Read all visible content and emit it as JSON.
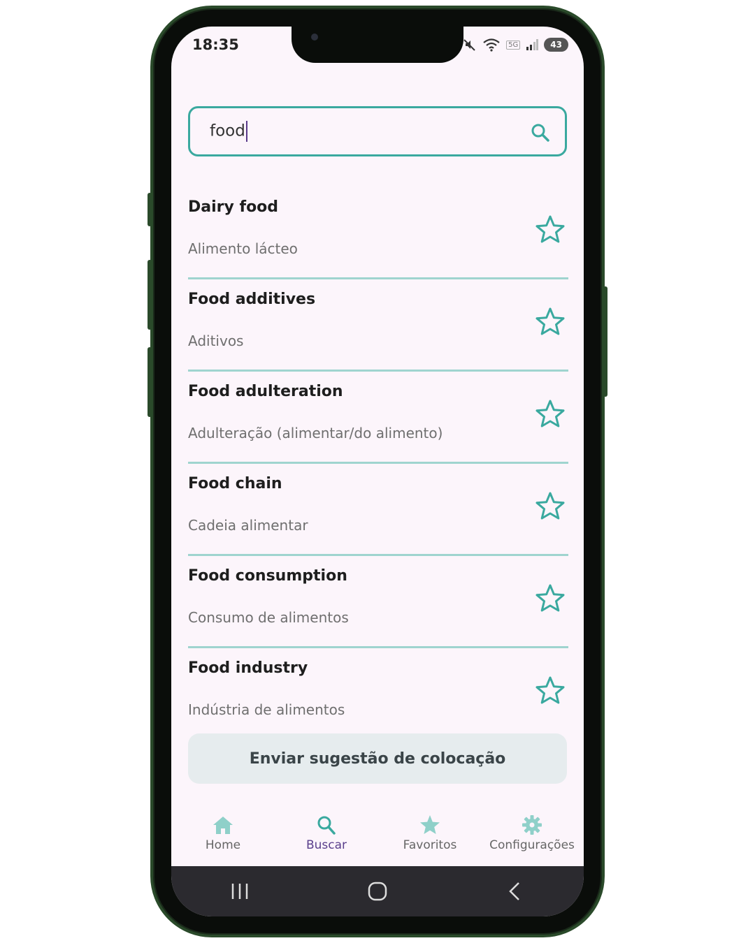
{
  "status_bar": {
    "time": "18:35",
    "battery": "43",
    "network_label": "5G"
  },
  "search": {
    "value": "food"
  },
  "results": [
    {
      "term": "Dairy food",
      "translation": "Alimento lácteo"
    },
    {
      "term": "Food additives",
      "translation": "Aditivos"
    },
    {
      "term": "Food adulteration",
      "translation": "Adulteração (alimentar/do alimento)"
    },
    {
      "term": "Food chain",
      "translation": "Cadeia alimentar"
    },
    {
      "term": "Food consumption",
      "translation": "Consumo de alimentos"
    },
    {
      "term": "Food industry",
      "translation": "Indústria de alimentos"
    }
  ],
  "suggest_button": {
    "label": "Enviar sugestão de colocação"
  },
  "bottom_nav": [
    {
      "label": "Home",
      "icon": "home-icon",
      "active": false
    },
    {
      "label": "Buscar",
      "icon": "search-icon",
      "active": true
    },
    {
      "label": "Favoritos",
      "icon": "star-icon",
      "active": false
    },
    {
      "label": "Configurações",
      "icon": "gear-icon",
      "active": false
    }
  ],
  "colors": {
    "accent": "#3aa99f",
    "active_nav": "#5a3f8c",
    "background": "#fcf5fb"
  }
}
